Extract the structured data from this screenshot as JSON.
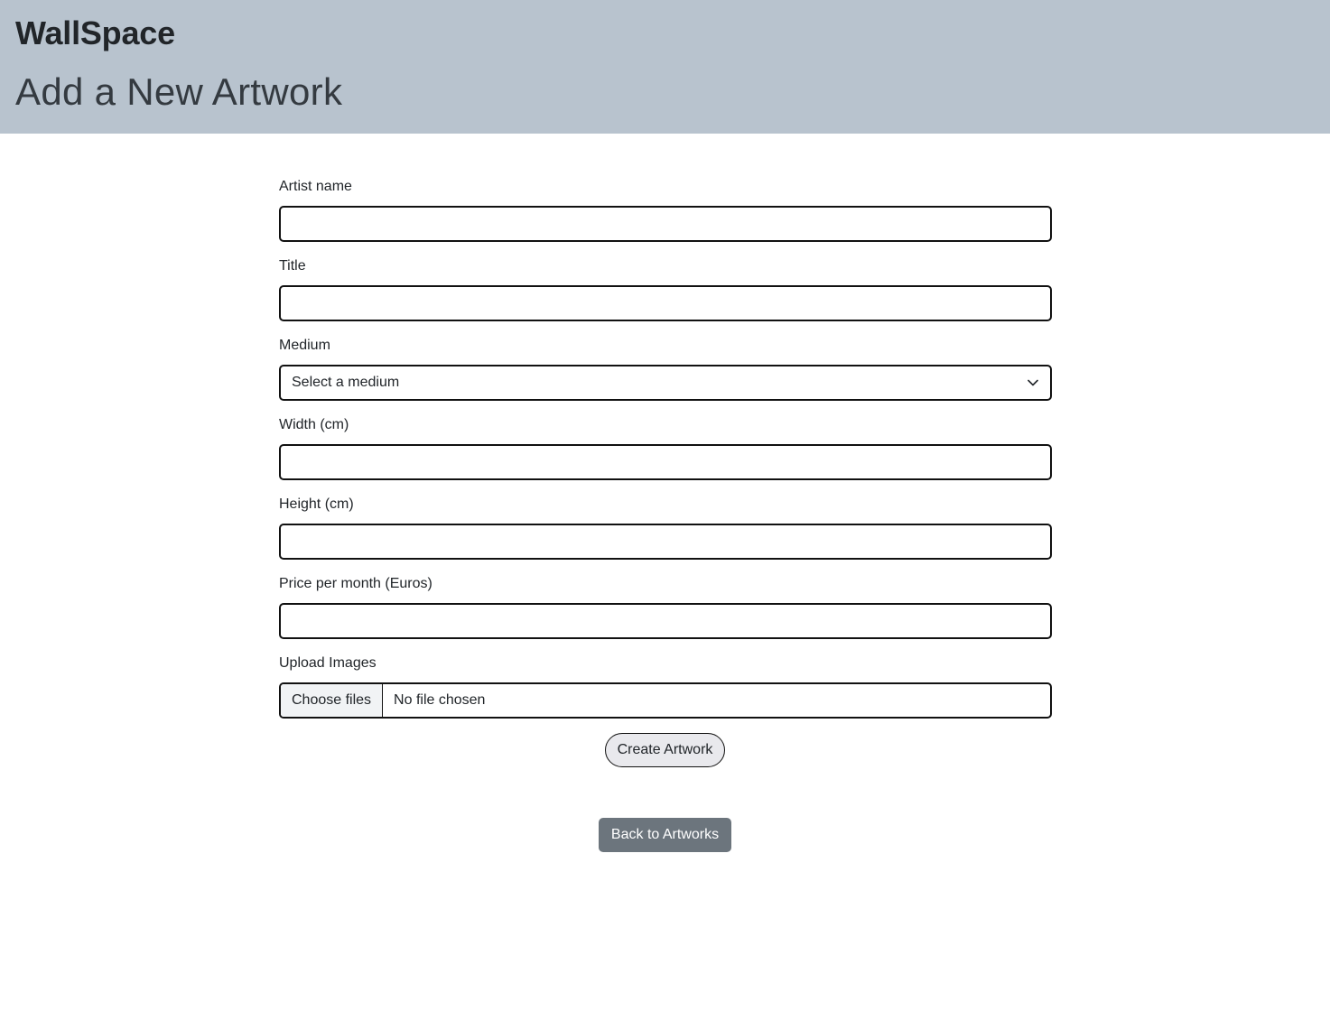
{
  "header": {
    "brand": "WallSpace",
    "title": "Add a New Artwork"
  },
  "form": {
    "artist_name": {
      "label": "Artist name",
      "value": ""
    },
    "title": {
      "label": "Title",
      "value": ""
    },
    "medium": {
      "label": "Medium",
      "selected": "Select a medium",
      "icon": "chevron-down-icon"
    },
    "width": {
      "label": "Width (cm)",
      "value": ""
    },
    "height": {
      "label": "Height (cm)",
      "value": ""
    },
    "price": {
      "label": "Price per month (Euros)",
      "value": ""
    },
    "upload": {
      "label": "Upload Images",
      "button": "Choose files",
      "status": "No file chosen"
    },
    "submit_label": "Create Artwork"
  },
  "back_link": "Back to Artworks",
  "colors": {
    "header_bg": "#b8c3ce",
    "back_button_bg": "#6c757d",
    "submit_bg": "#e9e9ed"
  }
}
